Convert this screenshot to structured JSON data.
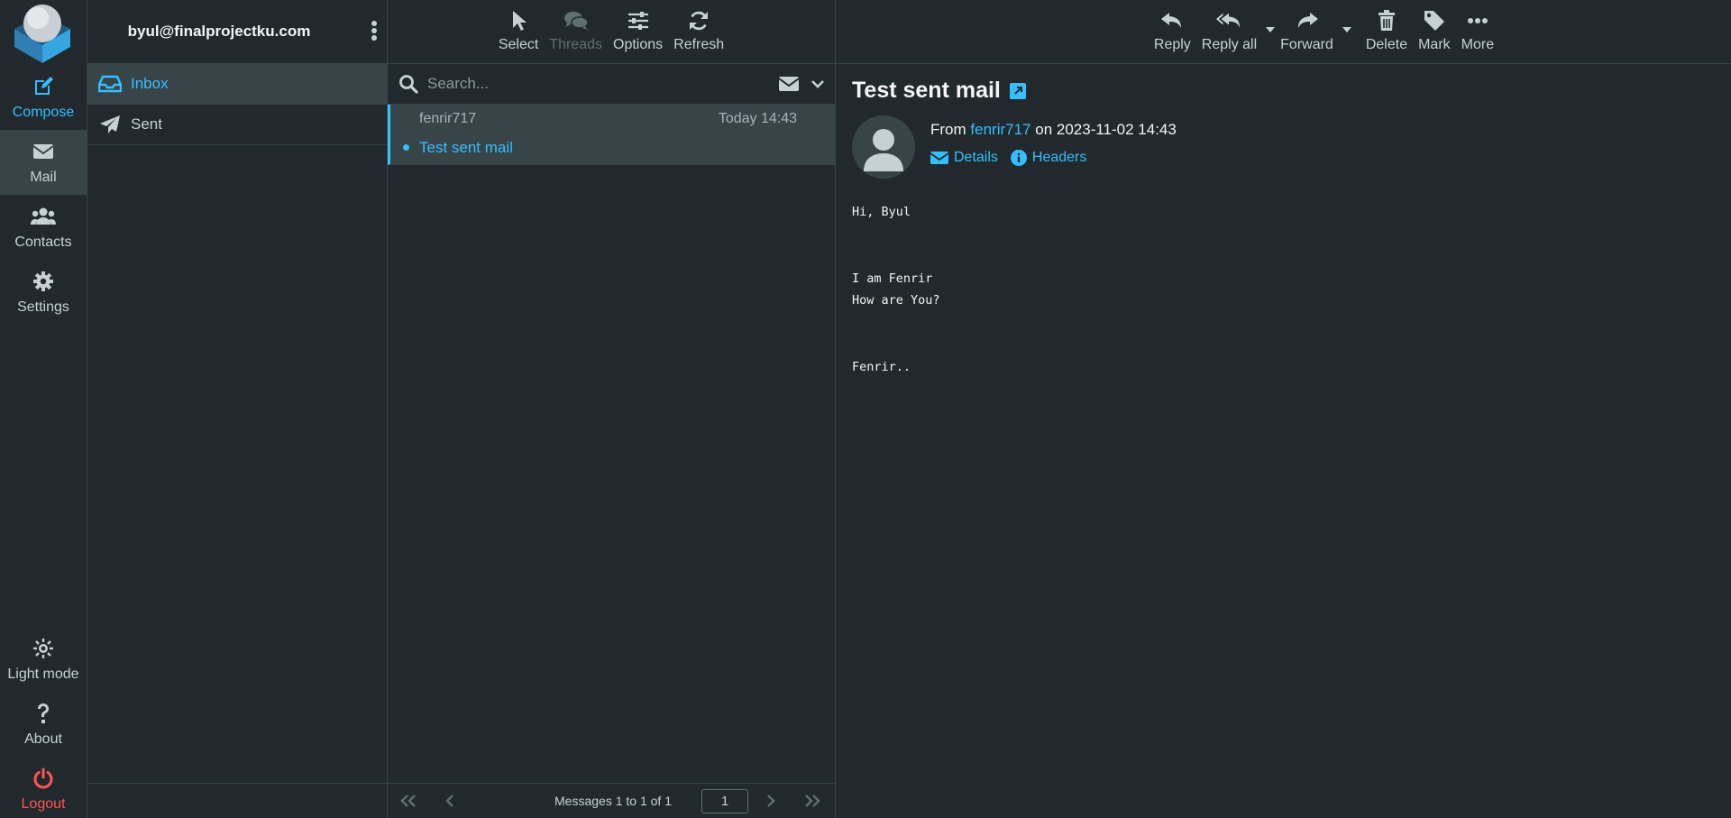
{
  "taskmenu": {
    "compose": "Compose",
    "mail": "Mail",
    "contacts": "Contacts",
    "settings": "Settings",
    "light_mode": "Light mode",
    "about": "About",
    "logout": "Logout"
  },
  "account": "byul@finalprojectku.com",
  "folders": [
    {
      "label": "Inbox",
      "icon": "inbox-icon",
      "selected": true
    },
    {
      "label": "Sent",
      "icon": "paper-plane-icon",
      "selected": false
    }
  ],
  "list_toolbar": {
    "select": "Select",
    "threads": "Threads",
    "options": "Options",
    "refresh": "Refresh"
  },
  "search": {
    "placeholder": "Search..."
  },
  "messages": [
    {
      "from": "fenrir717",
      "date": "Today 14:43",
      "subject": "Test sent mail",
      "unread": true
    }
  ],
  "pager": {
    "count_text": "Messages 1 to 1 of 1",
    "page": "1"
  },
  "content_toolbar": {
    "reply": "Reply",
    "reply_all": "Reply all",
    "forward": "Forward",
    "delete": "Delete",
    "mark": "Mark",
    "more": "More"
  },
  "mail": {
    "subject": "Test sent mail",
    "from_prefix": "From",
    "from_name": "fenrir717",
    "on_text": "on 2023-11-02 14:43",
    "details": "Details",
    "headers": "Headers",
    "body": "Hi, Byul\n\n\nI am Fenrir\nHow are You?\n\n\nFenrir.."
  },
  "colors": {
    "background": "#21292c",
    "selected": "#374549",
    "accent": "#37beff",
    "logout": "#ff5552"
  }
}
